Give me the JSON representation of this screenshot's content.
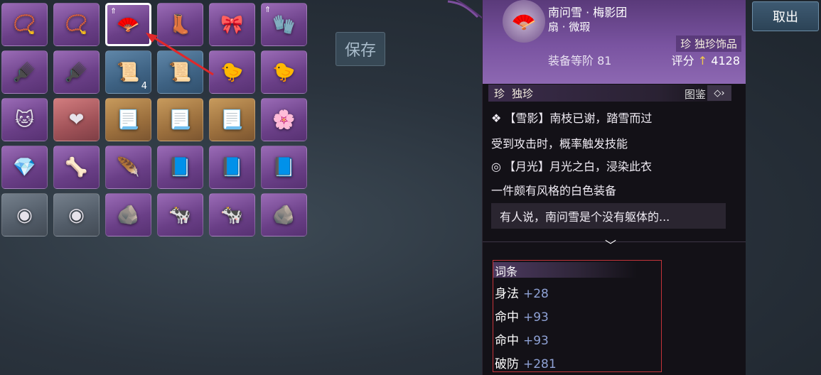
{
  "colors": {
    "panel_head": "#7a54a1",
    "attribute_value": "#8fa2d6",
    "highlight_box": "#c4343a",
    "score_arrow": "#f2c94c"
  },
  "save_button": {
    "label": "保存"
  },
  "take_out_button": {
    "label": "取出"
  },
  "inventory": {
    "rows": [
      [
        {
          "icon": "necklace-icon",
          "quality": "purple"
        },
        {
          "icon": "necklace-icon",
          "quality": "purple"
        },
        {
          "icon": "fan-icon",
          "quality": "purple",
          "selected": true,
          "badge": "upgrade-arrow"
        },
        {
          "icon": "boots-icon",
          "quality": "purple"
        },
        {
          "icon": "belt-icon",
          "quality": "purple"
        },
        {
          "icon": "bracer-icon",
          "quality": "purple",
          "badge": "upgrade-arrow"
        }
      ],
      [
        {
          "icon": "hairpin-icon",
          "quality": "purple"
        },
        {
          "icon": "hairpin-icon",
          "quality": "purple"
        },
        {
          "icon": "scroll-icon",
          "quality": "blue",
          "count": "4"
        },
        {
          "icon": "scroll-icon",
          "quality": "blue"
        },
        {
          "icon": "bird-plush-icon",
          "quality": "purple"
        },
        {
          "icon": "bird-plush-icon",
          "quality": "purple"
        }
      ],
      [
        {
          "icon": "cat-icon",
          "quality": "purple"
        },
        {
          "icon": "heart-icon",
          "quality": "red"
        },
        {
          "icon": "recipe-scroll-icon",
          "quality": "gold"
        },
        {
          "icon": "recipe-scroll-icon",
          "quality": "gold"
        },
        {
          "icon": "recipe-scroll-icon",
          "quality": "gold"
        },
        {
          "icon": "flower-icon",
          "quality": "purple"
        }
      ],
      [
        {
          "icon": "crystal-icon",
          "quality": "purple"
        },
        {
          "icon": "horn-icon",
          "quality": "purple"
        },
        {
          "icon": "feather-brush-icon",
          "quality": "purple"
        },
        {
          "icon": "manual-book-icon",
          "quality": "purple"
        },
        {
          "icon": "manual-book-icon",
          "quality": "purple"
        },
        {
          "icon": "manual-book-icon",
          "quality": "purple"
        }
      ],
      [
        {
          "icon": "orb-icon",
          "quality": "slate"
        },
        {
          "icon": "orb-icon",
          "quality": "slate"
        },
        {
          "icon": "stone-icon",
          "quality": "purple"
        },
        {
          "icon": "cow-icon",
          "quality": "purple"
        },
        {
          "icon": "cow-icon",
          "quality": "purple"
        },
        {
          "icon": "stone-icon",
          "quality": "purple"
        }
      ]
    ]
  },
  "item": {
    "name": "南问雪 · 梅影团",
    "type": "扇 · 微瑕",
    "rarity_tag": "珍 独珍饰品",
    "grade_label": "装备等阶 81",
    "score_label": "评分",
    "score_value": "4128",
    "rarity_seal": "珍",
    "rarity_name": "独珍",
    "codex_label": "图鉴",
    "effects": [
      {
        "icon": "snow-emblem-icon",
        "title": "【雪影】南枝已谢，踏雪而过",
        "desc": "受到攻击时，概率触发技能"
      },
      {
        "icon": "moon-swirl-icon",
        "title": "【月光】月光之白，浸染此衣",
        "desc": "一件颇有风格的白色装备"
      }
    ],
    "flavor": "有人说，南问雪是个没有躯体的..."
  },
  "attributes": {
    "title": "词条",
    "rows": [
      {
        "name": "身法",
        "value": "+28"
      },
      {
        "name": "命中",
        "value": "+93"
      },
      {
        "name": "命中",
        "value": "+93"
      },
      {
        "name": "破防",
        "value": "+281"
      }
    ]
  }
}
